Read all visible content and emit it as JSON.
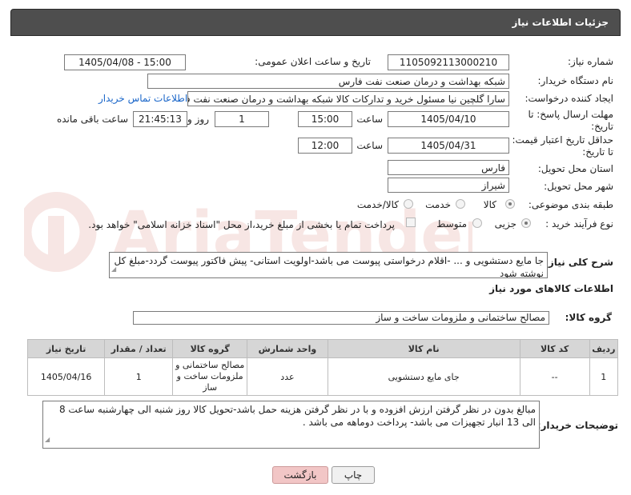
{
  "header": {
    "title": "جزئیات اطلاعات نیاز"
  },
  "fields": {
    "need_number_label": "شماره نیاز:",
    "need_number": "1105092113000210",
    "announce_label": "تاریخ و ساعت اعلان عمومی:",
    "announce_value": "1405/04/08 - 15:00",
    "buyer_org_label": "نام دستگاه خریدار:",
    "buyer_org": "شبکه بهداشت و درمان صنعت نفت فارس",
    "creator_label": "ایجاد کننده درخواست:",
    "creator": "سارا گلچین نیا مسئول خرید و تدارکات کالا شبکه بهداشت و درمان صنعت نفت فارس",
    "contact_link": "اطلاعات تماس خریدار",
    "deadline_label": "مهلت ارسال پاسخ: تا تاریخ:",
    "deadline_date": "1405/04/10",
    "time_label": "ساعت",
    "deadline_time": "15:00",
    "days_value": "1",
    "days_label": "روز و",
    "remaining_time": "21:45:13",
    "remaining_label": "ساعت باقی مانده",
    "validity_label": "حداقل تاریخ اعتبار قیمت: تا تاریخ:",
    "validity_date": "1405/04/31",
    "validity_time": "12:00",
    "province_label": "استان محل تحویل:",
    "province": "فارس",
    "city_label": "شهر محل تحویل:",
    "city": "شیراز",
    "category_label": "طبقه بندی موضوعی:",
    "category_options": [
      "کالا",
      "خدمت",
      "کالا/خدمت"
    ],
    "category_selected": "کالا",
    "process_label": "نوع فرآیند خرید :",
    "process_options": [
      "جزیی",
      "متوسط"
    ],
    "process_selected": "جزیی",
    "payment_note": "پرداخت تمام یا بخشی از مبلغ خرید،از محل \"اسناد خزانه اسلامی\" خواهد بود."
  },
  "description": {
    "label": "شرح کلی نیاز:",
    "text": "جا مایع دستشویی و ... -اقلام درخواستی پیوست می باشد-اولویت استانی- پیش فاکتور پیوست گردد-مبلغ کل نوشته شود"
  },
  "goods_section": {
    "title": "اطلاعات کالاهای مورد نیاز",
    "group_label": "گروه کالا:",
    "group_value": "مصالح ساختمانی و ملزومات ساخت و ساز"
  },
  "table": {
    "headers": [
      "ردیف",
      "کد کالا",
      "نام کالا",
      "واحد شمارش",
      "گروه کالا",
      "تعداد / مقدار",
      "تاریخ نیاز"
    ],
    "rows": [
      [
        "1",
        "--",
        "جای مایع دستشویی",
        "عدد",
        "مصالح ساختمانی و ملزومات ساخت و ساز",
        "1",
        "1405/04/16"
      ]
    ]
  },
  "buyer_notes": {
    "label": "توضیحات خریدار:",
    "text": "مبالغ بدون در نظر گرفتن ارزش افزوده و با در نظر گرفتن هزینه حمل باشد-تحویل کالا روز شنبه الی چهارشنبه ساعت 8 الی 13 انبار تجهیزات می باشد- پرداخت دوماهه می باشد ."
  },
  "buttons": {
    "print": "چاپ",
    "back": "بازگشت"
  },
  "watermark": "AriaTender.net",
  "colors": {
    "header_bg": "#4e4e4e",
    "link": "#1a66c9",
    "back_btn": "#f2c6c6",
    "table_head": "#d6d6d6",
    "watermark": "#c0392b"
  }
}
